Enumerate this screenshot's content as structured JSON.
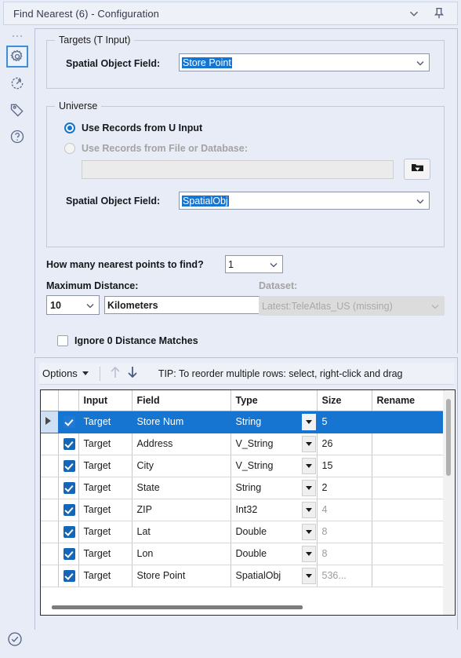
{
  "window": {
    "title": "Find Nearest (6) - Configuration",
    "chevron_icon": "chevron-down-icon",
    "pin_icon": "pin-icon"
  },
  "rail": {
    "items": [
      {
        "icon": "gear-icon",
        "name": "configuration",
        "selected": true
      },
      {
        "icon": "refresh-arrow-icon",
        "name": "workflow",
        "selected": false
      },
      {
        "icon": "tag-icon",
        "name": "annotation",
        "selected": false
      },
      {
        "icon": "question-mark-icon",
        "name": "help",
        "selected": false
      }
    ]
  },
  "targets_group": {
    "title": "Targets (T Input)",
    "spatial_label": "Spatial Object Field:",
    "spatial_value": "Store Point"
  },
  "universe_group": {
    "title": "Universe",
    "radio_u_input": "Use Records from U Input",
    "radio_file_db": "Use Records from File or Database:",
    "file_path_value": "",
    "browse_icon": "folder-dropdown-icon",
    "spatial_label": "Spatial Object Field:",
    "spatial_value": "SpatialObj"
  },
  "nearest": {
    "label": "How many nearest points to find?",
    "value": "1"
  },
  "max_distance": {
    "label": "Maximum Distance:",
    "value": "10",
    "units": "Kilometers"
  },
  "dataset": {
    "label": "Dataset:",
    "value": "Latest:TeleAtlas_US (missing)"
  },
  "ignore_zero": {
    "label": "Ignore 0 Distance Matches",
    "checked": false
  },
  "toolbar": {
    "options_label": "Options",
    "move_up_icon": "arrow-up-icon",
    "move_down_icon": "arrow-down-icon",
    "tip": "TIP: To reorder multiple rows: select, right-click and drag"
  },
  "grid": {
    "headers": [
      "",
      "",
      "Input",
      "Field",
      "Type",
      "Size",
      "Rename"
    ],
    "rows": [
      {
        "selected": true,
        "checked": true,
        "input": "Target",
        "field": "Store Num",
        "type": "String",
        "size": "5",
        "size_dim": false,
        "rename": ""
      },
      {
        "selected": false,
        "checked": true,
        "input": "Target",
        "field": "Address",
        "type": "V_String",
        "size": "26",
        "size_dim": false,
        "rename": ""
      },
      {
        "selected": false,
        "checked": true,
        "input": "Target",
        "field": "City",
        "type": "V_String",
        "size": "15",
        "size_dim": false,
        "rename": ""
      },
      {
        "selected": false,
        "checked": true,
        "input": "Target",
        "field": "State",
        "type": "String",
        "size": "2",
        "size_dim": false,
        "rename": ""
      },
      {
        "selected": false,
        "checked": true,
        "input": "Target",
        "field": "ZIP",
        "type": "Int32",
        "size": "4",
        "size_dim": true,
        "rename": ""
      },
      {
        "selected": false,
        "checked": true,
        "input": "Target",
        "field": "Lat",
        "type": "Double",
        "size": "8",
        "size_dim": true,
        "rename": ""
      },
      {
        "selected": false,
        "checked": true,
        "input": "Target",
        "field": "Lon",
        "type": "Double",
        "size": "8",
        "size_dim": true,
        "rename": ""
      },
      {
        "selected": false,
        "checked": true,
        "input": "Target",
        "field": "Store Point",
        "type": "SpatialObj",
        "size": "536...",
        "size_dim": true,
        "rename": ""
      }
    ]
  },
  "status": {
    "icon": "check-circle-icon"
  }
}
